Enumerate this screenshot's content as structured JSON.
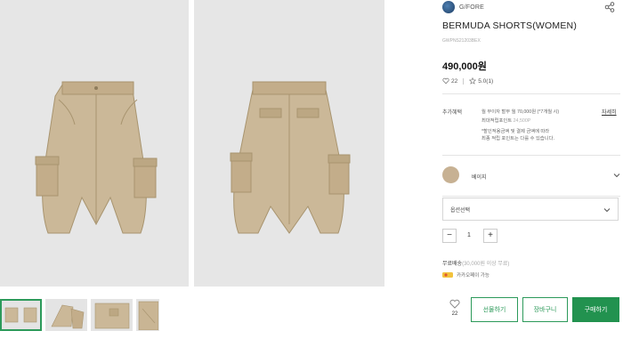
{
  "brand": {
    "name": "G/FORE",
    "share_icon": "share-icon"
  },
  "product": {
    "title": "BERMUDA SHORTS(WOMEN)",
    "code": "GWPNS21203BEX",
    "price": "490,000원",
    "likes": "22",
    "rating": "5.0",
    "review_count": "(1)"
  },
  "benefits": {
    "label": "추가혜택",
    "more": "자세히",
    "lines": [
      {
        "text": "월 무이자 할부 월 70,000원 (*7개월 시)",
        "accent": ""
      },
      {
        "text": "최대적립포인트 ",
        "accent": "24,500P"
      },
      {
        "text": "*할인적용금액 및 결제 금액에 따라",
        "accent": ""
      },
      {
        "text": "최종 적립 포인트는 다를 수 있습니다.",
        "accent": ""
      }
    ]
  },
  "color_option": {
    "name": "베이지",
    "swatch": "#c7b193"
  },
  "option_select": {
    "placeholder": "옵션선택"
  },
  "quantity": {
    "minus": "−",
    "value": "1",
    "plus": "+"
  },
  "shipping": {
    "prefix": "무료배송",
    "accent": "(30,000원 이상 무료)"
  },
  "payment": {
    "text": "카카오페이 가능"
  },
  "actions": {
    "like_count": "22",
    "gift": "선물하기",
    "cart": "장바구니",
    "buy": "구매하기"
  },
  "colors": {
    "accent": "#2c9a5a",
    "buy_bg": "#22924f",
    "photo_bg": "#e6e6e6",
    "garment": "#cbb898"
  }
}
